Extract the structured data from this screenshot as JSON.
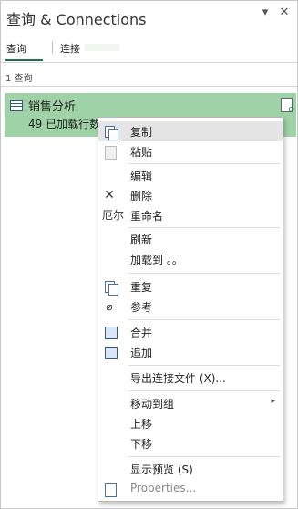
{
  "pane": {
    "title": "查询 & Connections",
    "close_icon": "close-icon",
    "pin_icon": "chevron-down-icon"
  },
  "tabs": [
    {
      "label": "查询",
      "active": true
    },
    {
      "label": "连接",
      "active": false
    }
  ],
  "query_count": "1 查询",
  "query": {
    "name": "销售分析",
    "status": "49 已加载行数"
  },
  "context_menu": {
    "items": [
      {
        "label": "复制",
        "icon": "copy-icon",
        "enabled": true
      },
      {
        "label": "粘贴",
        "icon": "paste-icon",
        "enabled": true
      },
      {
        "label": "编辑",
        "icon": "",
        "enabled": true
      },
      {
        "label": "删除",
        "icon": "delete-icon",
        "enabled": true
      },
      {
        "label": "重命名",
        "icon_text": "厄尔",
        "enabled": true
      },
      {
        "label": "刷新",
        "icon": "",
        "enabled": true
      },
      {
        "label": "加载到 。。",
        "icon": "",
        "enabled": true
      },
      {
        "label": "重复",
        "icon": "duplicate-icon",
        "enabled": true
      },
      {
        "label": "参考",
        "icon": "paperclip-icon",
        "enabled": true
      },
      {
        "label": "合并",
        "icon": "merge-icon",
        "enabled": true
      },
      {
        "label": "追加",
        "icon": "append-icon",
        "enabled": true
      },
      {
        "label": "导出连接文件 (X)...",
        "icon": "",
        "enabled": true
      },
      {
        "label": "移动到组",
        "icon": "",
        "enabled": true,
        "submenu": true
      },
      {
        "label": "上移",
        "icon": "",
        "enabled": true
      },
      {
        "label": "下移",
        "icon": "",
        "enabled": true
      },
      {
        "label": "显示预览 (S)",
        "icon": "",
        "enabled": true
      },
      {
        "label": "Properties...",
        "icon": "properties-icon",
        "enabled": false
      }
    ],
    "submenu_arrow": "▸",
    "delete_glyph": "✕",
    "paperclip_glyph": "⌀"
  }
}
